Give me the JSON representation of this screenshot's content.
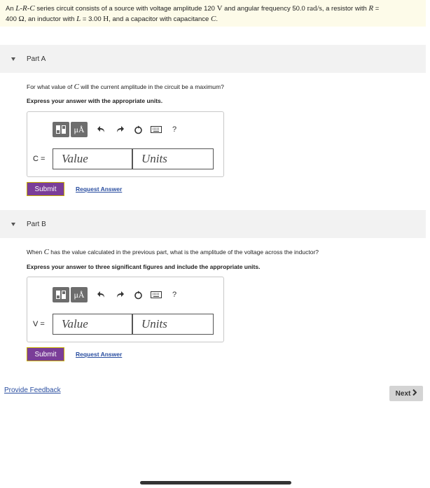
{
  "problem": {
    "text_1": "An ",
    "lrc": "L-R-C",
    "text_2": " series circuit consists of a source with voltage amplitude 120 ",
    "unit_v": "V",
    "text_3": " and angular frequency 50.0 ",
    "unit_rad": "rad/s",
    "text_4": ", a resistor with ",
    "var_r": "R",
    "text_5": " =",
    "line2_1": "400 ",
    "unit_ohm": "Ω",
    "line2_2": ", an inductor with ",
    "var_l": "L",
    "line2_3": " = 3.00 ",
    "unit_h": "H",
    "line2_4": ", and a capacitor with capacitance ",
    "var_c": "C",
    "line2_5": "."
  },
  "part_a": {
    "title": "Part A",
    "question_1": "For what value of ",
    "question_var": "C",
    "question_2": " will the current amplitude in the circuit be a maximum?",
    "instruction": "Express your answer with the appropriate units.",
    "var_label": "C =",
    "value_placeholder": "Value",
    "units_placeholder": "Units",
    "submit_label": "Submit",
    "request_label": "Request Answer"
  },
  "part_b": {
    "title": "Part B",
    "question_1": "When ",
    "question_var": "C",
    "question_2": " has the value calculated in the previous part, what is the amplitude of the voltage across the inductor?",
    "instruction": "Express your answer to three significant figures and include the appropriate units.",
    "var_label": "V =",
    "value_placeholder": "Value",
    "units_placeholder": "Units",
    "submit_label": "Submit",
    "request_label": "Request Answer"
  },
  "toolbar": {
    "mu_label": "μÅ",
    "help_label": "?",
    "icons": [
      "templates-icon",
      "units-icon",
      "undo-icon",
      "redo-icon",
      "reset-icon",
      "keyboard-icon",
      "help-icon"
    ]
  },
  "footer": {
    "feedback_label": "Provide Feedback",
    "next_label": "Next"
  },
  "colors": {
    "submit_bg": "#7a3d98",
    "link": "#2a4ea0",
    "problem_bg": "#fdfbe9",
    "part_header_bg": "#f2f2f2"
  }
}
